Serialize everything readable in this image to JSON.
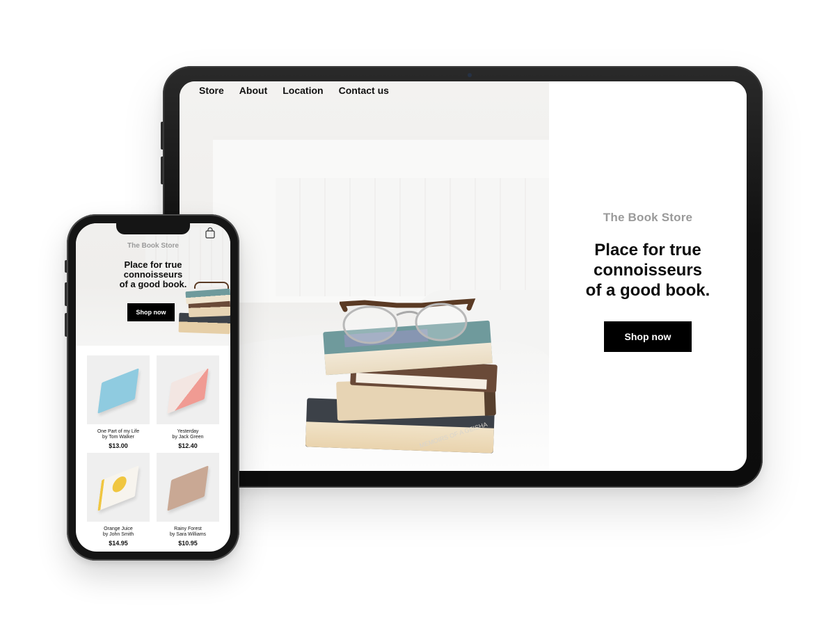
{
  "tablet": {
    "nav": [
      "Store",
      "About",
      "Location",
      "Contact us"
    ],
    "brand": "The Book Store",
    "headline": "Place for true\nconnoisseurs\nof a good book.",
    "cta_label": "Shop now",
    "book_spine_text": "MEMOIRS OF A GEISHA"
  },
  "phone": {
    "brand": "The Book Store",
    "headline": "Place for true\nconnoisseurs\nof a good book.",
    "cta_label": "Shop now",
    "products": [
      {
        "title": "One Part of my Life",
        "author": "by Tom Walker",
        "price": "$13.00",
        "cover_color": "#8fcbe0"
      },
      {
        "title": "Yesterday",
        "author": "by Jack Green",
        "price": "$12.40",
        "cover_color": "#f2a9a3"
      },
      {
        "title": "Orange Juice",
        "author": "by John Smith",
        "price": "$14.95",
        "cover_color": "#f0c640"
      },
      {
        "title": "Rainy Forest",
        "author": "by Sara Williams",
        "price": "$10.95",
        "cover_color": "#c9a894"
      }
    ]
  },
  "colors": {
    "cta_background": "#000000",
    "brand_text": "#9a9a9a",
    "device_frame": "#111111"
  },
  "icons": [
    "shopping-bag-icon"
  ]
}
